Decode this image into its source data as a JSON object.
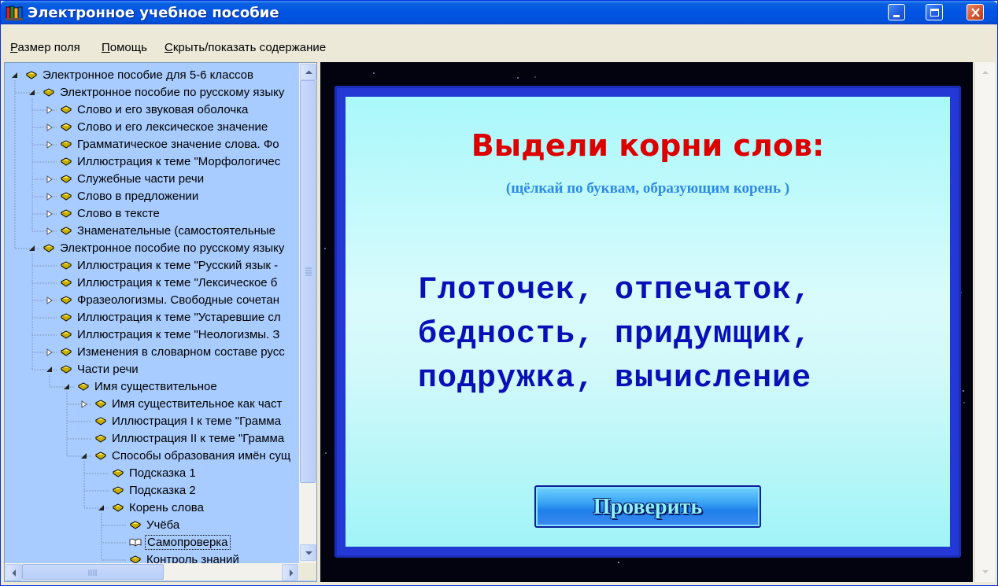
{
  "window": {
    "title": "Электронное учебное пособие",
    "buttons": [
      "minimize",
      "maximize",
      "close"
    ]
  },
  "menu": {
    "items": [
      {
        "label": "Размер поля",
        "accel": "Р",
        "rest": "азмер поля"
      },
      {
        "label": "Помощь",
        "accel": "П",
        "rest": "омощь"
      },
      {
        "label": "Скрыть/показать содержание",
        "accel": "С",
        "rest": "крыть/показать содержание"
      }
    ]
  },
  "tree": {
    "items": [
      {
        "label": "Электронное пособие для 5-6 классов",
        "level": 0,
        "state": "expanded"
      },
      {
        "label": "Электронное пособие по русскому языку",
        "level": 1,
        "state": "expanded"
      },
      {
        "label": "Слово и его звуковая оболочка",
        "level": 2,
        "state": "collapsed"
      },
      {
        "label": "Слово и его лексическое значение",
        "level": 2,
        "state": "collapsed"
      },
      {
        "label": "Грамматическое значение слова. Фо",
        "level": 2,
        "state": "collapsed"
      },
      {
        "label": "Иллюстрация к теме \"Морфологичес",
        "level": 2,
        "state": "leaf"
      },
      {
        "label": "Служебные части речи",
        "level": 2,
        "state": "collapsed"
      },
      {
        "label": "Слово в предложении",
        "level": 2,
        "state": "collapsed"
      },
      {
        "label": "Слово в тексте",
        "level": 2,
        "state": "collapsed"
      },
      {
        "label": "Знаменательные (самостоятельные",
        "level": 2,
        "state": "collapsed"
      },
      {
        "label": "Электронное пособие по русскому языку",
        "level": 1,
        "state": "expanded"
      },
      {
        "label": "Иллюстрация к теме \"Русский язык -",
        "level": 2,
        "state": "leaf"
      },
      {
        "label": "Иллюстрация к теме \"Лексическое б",
        "level": 2,
        "state": "leaf"
      },
      {
        "label": "Фразеологизмы. Свободные сочетан",
        "level": 2,
        "state": "collapsed"
      },
      {
        "label": "Иллюстрация к теме \"Устаревшие сл",
        "level": 2,
        "state": "leaf"
      },
      {
        "label": "Иллюстрация к теме \"Неологизмы. З",
        "level": 2,
        "state": "leaf"
      },
      {
        "label": "Изменения в словарном составе русс",
        "level": 2,
        "state": "collapsed"
      },
      {
        "label": "Части речи",
        "level": 2,
        "state": "expanded"
      },
      {
        "label": "Имя существительное",
        "level": 3,
        "state": "expanded"
      },
      {
        "label": "Имя существительное как част",
        "level": 4,
        "state": "collapsed"
      },
      {
        "label": "Иллюстрация I к теме \"Грамма",
        "level": 4,
        "state": "leaf"
      },
      {
        "label": "Иллюстрация II к теме \"Грамма",
        "level": 4,
        "state": "leaf"
      },
      {
        "label": "Способы образования имён сущ",
        "level": 4,
        "state": "expanded"
      },
      {
        "label": "Подсказка 1",
        "level": 5,
        "state": "leaf"
      },
      {
        "label": "Подсказка 2",
        "level": 5,
        "state": "leaf"
      },
      {
        "label": "Корень слова",
        "level": 5,
        "state": "expanded"
      },
      {
        "label": "Учёба",
        "level": 6,
        "state": "leaf"
      },
      {
        "label": "Самопроверка",
        "level": 6,
        "state": "selected"
      },
      {
        "label": "Контроль знаний",
        "level": 6,
        "state": "leaf"
      }
    ]
  },
  "exercise": {
    "title": "Выдели корни слов:",
    "hint": "(щёлкай по буквам, образующим корень )",
    "lines": [
      "Глоточек, отпечаток,",
      "бедность, придумщик,",
      "подружка, вычисление"
    ],
    "check_button": "Проверить"
  },
  "colors": {
    "title_red": "#DD0000",
    "words_blue": "#0A10B8",
    "hint_blue": "#2D8AE6",
    "tree_bg": "#A8CCFF",
    "frame_blue": "#2438D6"
  }
}
